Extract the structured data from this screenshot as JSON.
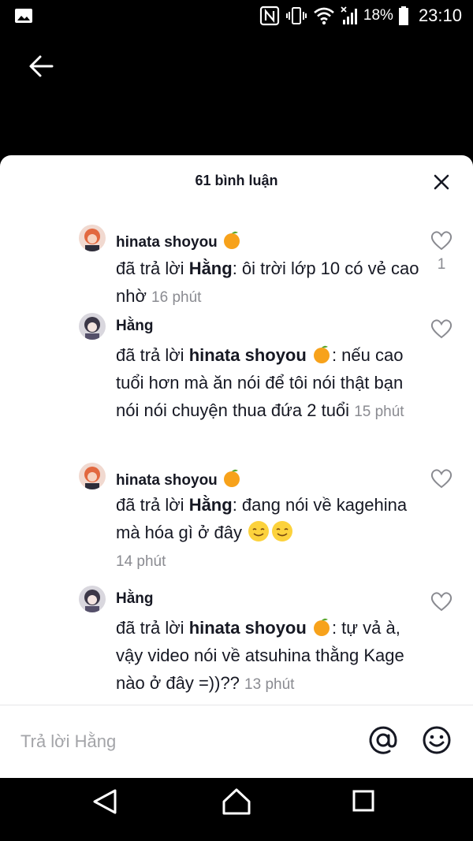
{
  "status_bar": {
    "battery_text": "18%",
    "time": "23:10",
    "icons": [
      "image-icon",
      "nfc-icon",
      "vibrate-icon",
      "wifi-icon",
      "signal-icon",
      "battery-icon"
    ]
  },
  "header": {
    "back_icon": "arrow-left-icon"
  },
  "sheet": {
    "title": "61 bình luận",
    "close_icon": "close-icon"
  },
  "comments": [
    {
      "user": "hinata shoyou",
      "prefix": "đã trả lời ",
      "reply_to": "Hằng",
      "text": ": ôi trời lớp 10 có vẻ cao nhờ",
      "time": "16 phút",
      "likes": "1"
    },
    {
      "user": "Hằng",
      "prefix": "đã trả lời ",
      "reply_to": "hinata shoyou",
      "text": ": nếu cao tuổi hơn mà ăn nói để tôi nói thật bạn nói nói chuyện thua đứa 2 tuổi",
      "time": "15 phút",
      "likes": ""
    },
    {
      "user": "hinata shoyou",
      "prefix": "đã trả lời ",
      "reply_to": "Hằng",
      "text": ": đang nói về kagehina mà hóa gì ở đây",
      "time": "14 phút",
      "likes": ""
    },
    {
      "user": "Hằng",
      "prefix": "đã trả lời ",
      "reply_to": "hinata shoyou",
      "text": ": tự vả à, vậy video nói về atsuhina thằng Kage nào ở đây =))??",
      "time": "13 phút",
      "likes": ""
    }
  ],
  "input": {
    "placeholder": "Trả lời Hằng"
  },
  "colors": {
    "text_primary": "#161823",
    "text_secondary": "#8a8b91",
    "placeholder": "#a3a4a8",
    "sheet_bg": "#ffffff",
    "chrome_bg": "#000000"
  }
}
